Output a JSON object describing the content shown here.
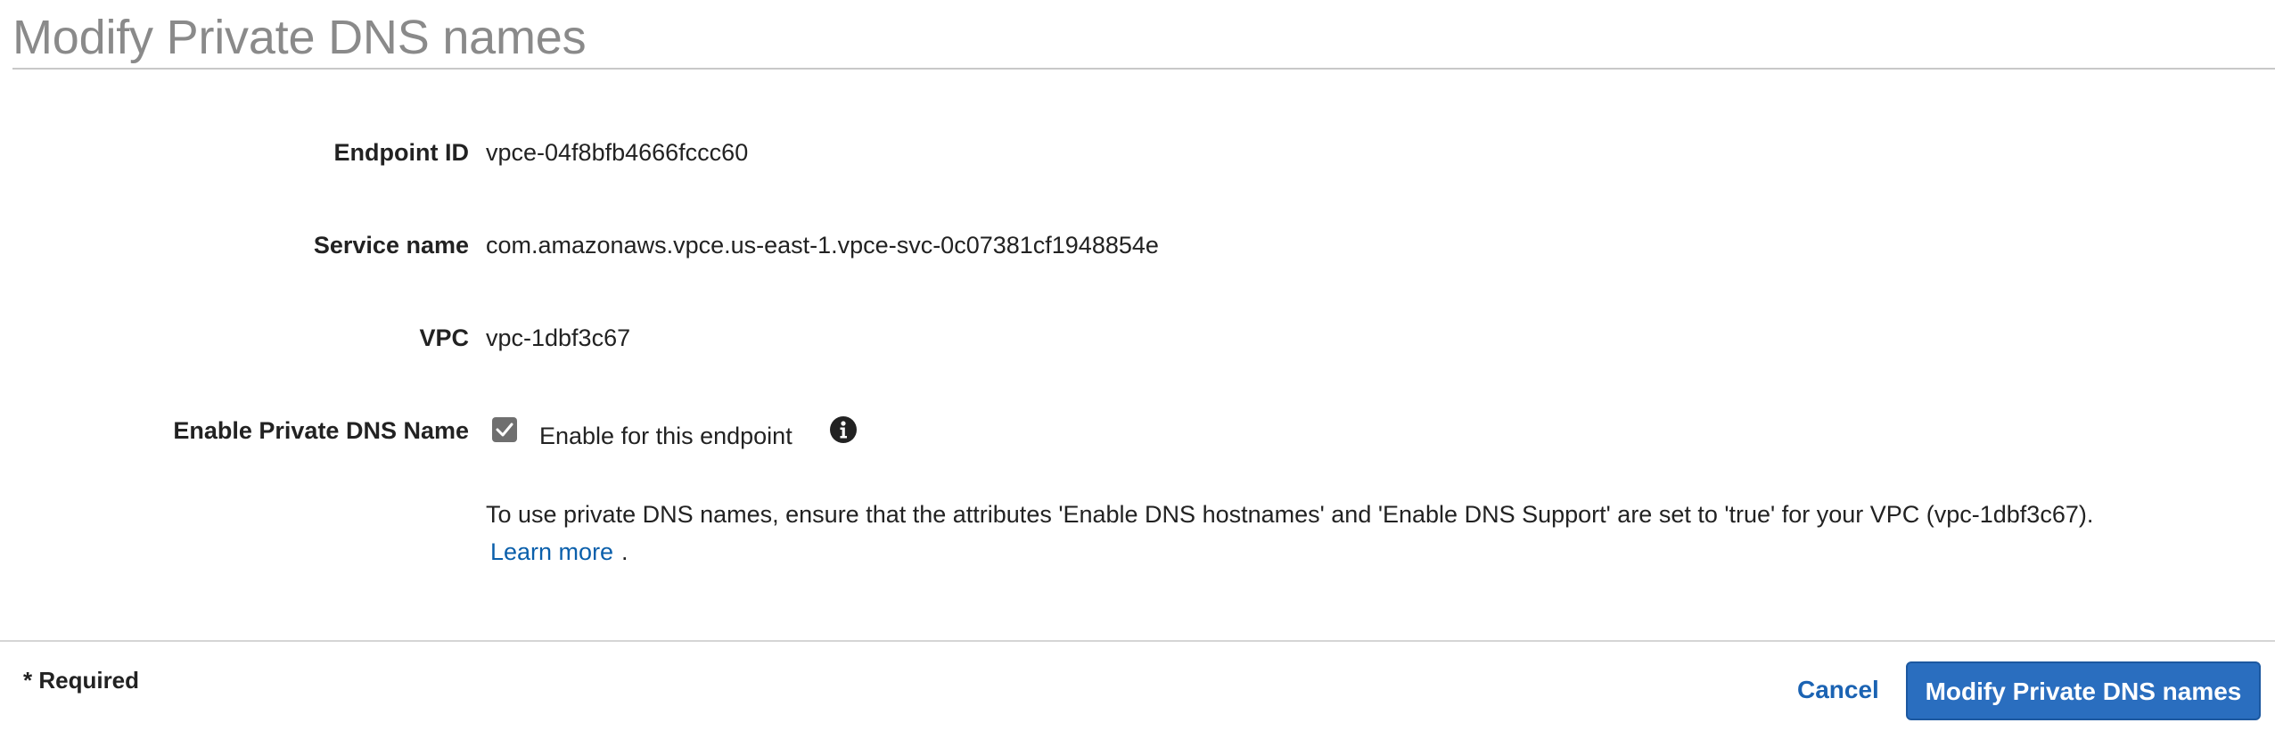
{
  "header": {
    "title": "Modify Private DNS names"
  },
  "form": {
    "endpoint_id": {
      "label": "Endpoint ID",
      "value": "vpce-04f8bfb4666fccc60"
    },
    "service_name": {
      "label": "Service name",
      "value": "com.amazonaws.vpce.us-east-1.vpce-svc-0c07381cf1948854e"
    },
    "vpc": {
      "label": "VPC",
      "value": "vpc-1dbf3c67"
    },
    "private_dns": {
      "label": "Enable Private DNS Name",
      "checkbox_label": "Enable for this endpoint",
      "checked": true,
      "info_icon": "info-circle-icon",
      "hint": "To use private DNS names, ensure that the attributes 'Enable DNS hostnames' and 'Enable DNS Support' are set to 'true' for your VPC (vpc-1dbf3c67).",
      "learn_more": "Learn more",
      "learn_more_suffix": "."
    }
  },
  "footer": {
    "required_text": "* Required",
    "cancel_label": "Cancel",
    "submit_label": "Modify Private DNS names"
  },
  "colors": {
    "title": "#8a8a8a",
    "link": "#0a5fab",
    "primary_button": "#2a6ebf",
    "checkbox": "#6f6f6f"
  }
}
